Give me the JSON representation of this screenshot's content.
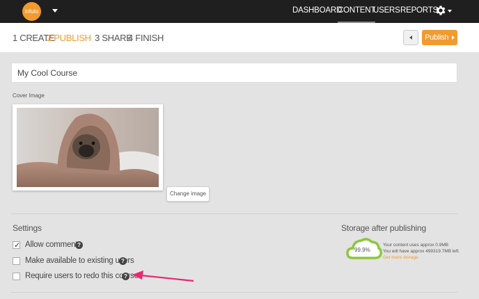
{
  "brand": {
    "logo_text": "infuto",
    "logo_color": "#f29a2e"
  },
  "nav": {
    "items": [
      {
        "label": "DASHBOARD"
      },
      {
        "label": "CONTENT",
        "active": true
      },
      {
        "label": "USERS"
      },
      {
        "label": "REPORTS"
      }
    ],
    "settings_icon": "gear-icon"
  },
  "steps": {
    "items": [
      {
        "label": "1 CREATE"
      },
      {
        "label": "2 PUBLISH",
        "current": true
      },
      {
        "label": "3 SHARE"
      },
      {
        "label": "4 FINISH"
      }
    ],
    "publish_label": "Publish",
    "back_icon": "caret-left-icon"
  },
  "course": {
    "title": "My Cool Course"
  },
  "cover": {
    "label": "Cover Image",
    "change_label": "Change image"
  },
  "settings": {
    "title": "Settings",
    "options": [
      {
        "label": "Allow comments",
        "checked": true
      },
      {
        "label": "Make available to existing users",
        "checked": false
      },
      {
        "label": "Require users to redo this course",
        "checked": false
      }
    ],
    "help_icon": "question-circle-icon"
  },
  "storage": {
    "title": "Storage after publishing",
    "percent": "99.9%",
    "line1": "Your content uses approx 0.9MB",
    "line2": "You will have approx 499319.7MB left.",
    "link": "Get more storage",
    "cloud_color": "#8cc63f"
  },
  "annotation": {
    "arrow_color": "#e8286f"
  }
}
